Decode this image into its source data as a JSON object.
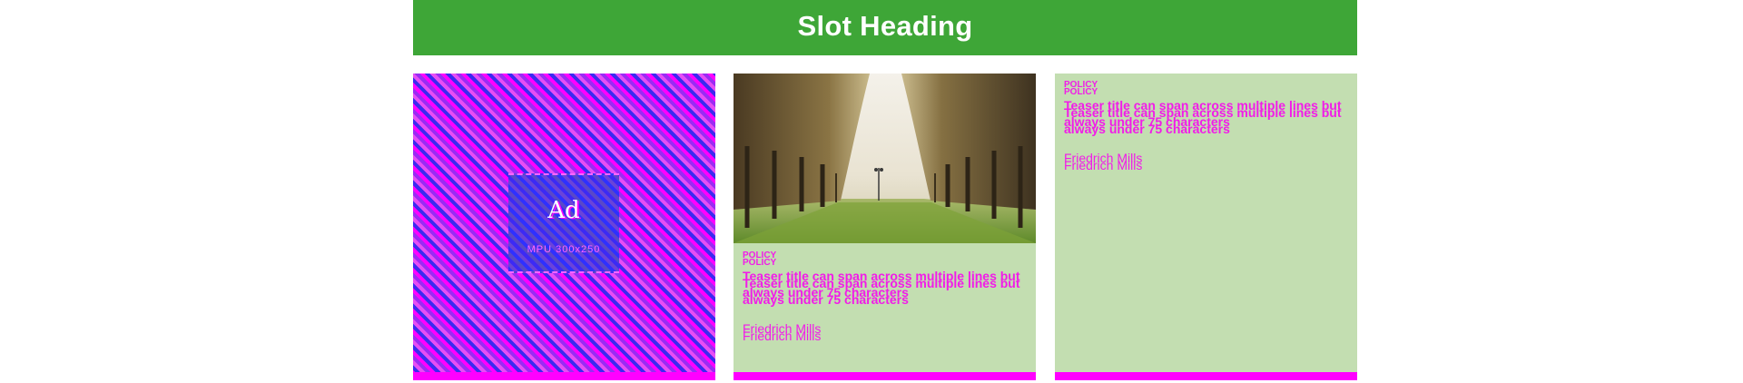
{
  "slot": {
    "heading": "Slot Heading"
  },
  "ad": {
    "label": "Ad",
    "size_text": "MPU 300x250"
  },
  "teasers": [
    {
      "category": "POLICY",
      "title": "Teaser title can span across multiple lines but always under 75 characters",
      "author": "Friedrich Mills",
      "image": "palm-avenue-photo"
    },
    {
      "category": "POLICY",
      "title": "Teaser title can span across multiple lines but always under 75 characters",
      "author": "Friedrich Mills"
    }
  ],
  "colors": {
    "heading_bg": "#3ea637",
    "heading_text": "#ffffff",
    "card_bg": "#c3deb1",
    "accent": "#ff00ff",
    "teaser_text": "#f21be9"
  }
}
